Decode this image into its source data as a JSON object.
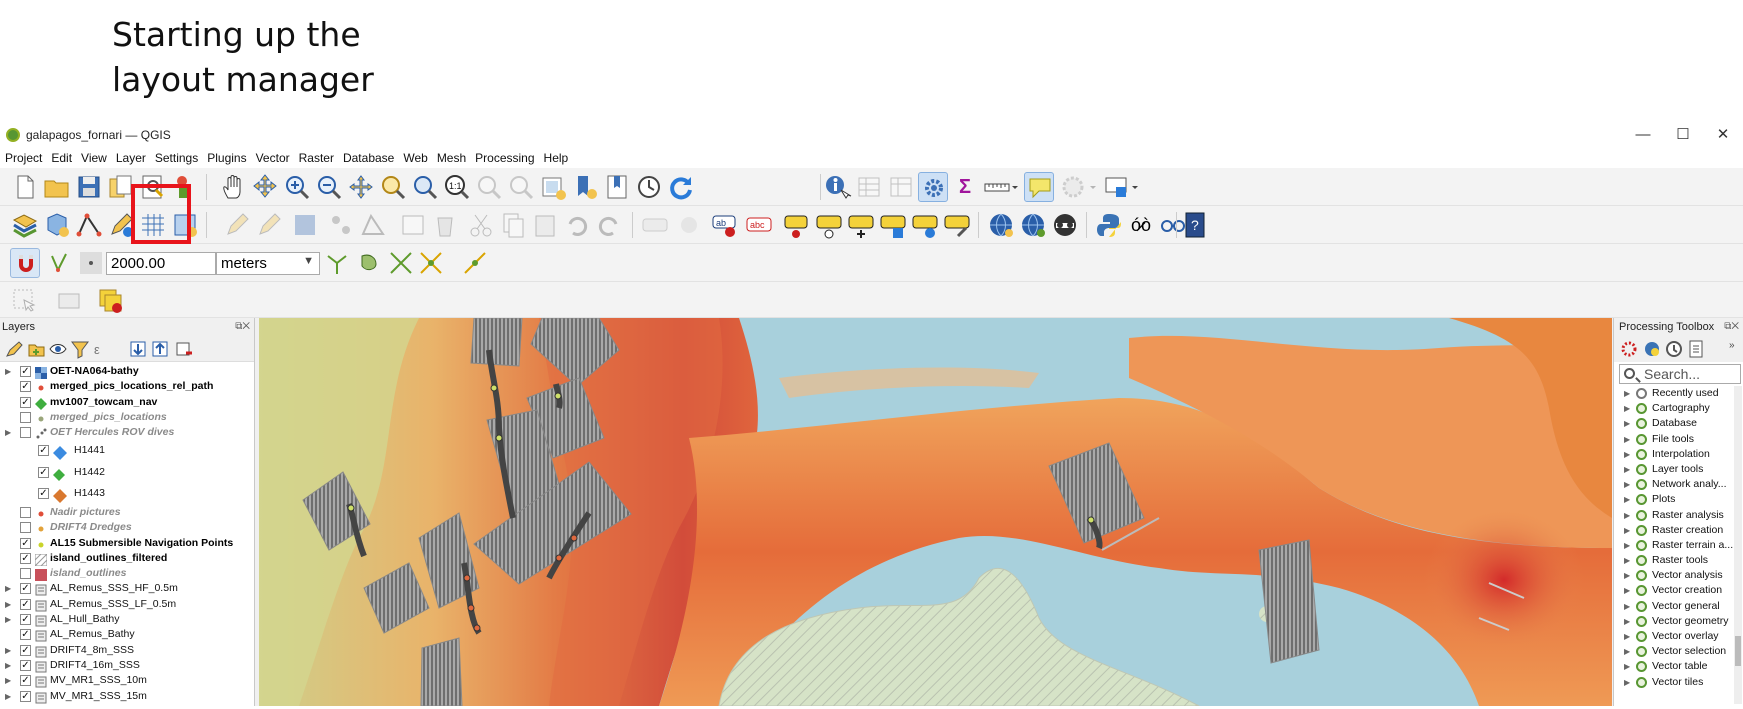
{
  "slide": {
    "title": "Starting up the\nlayout manager"
  },
  "window": {
    "title": "galapagos_fornari — QGIS",
    "minimize": "—",
    "maximize": "☐",
    "close": "✕"
  },
  "menu": [
    "Project",
    "Edit",
    "View",
    "Layer",
    "Settings",
    "Plugins",
    "Vector",
    "Raster",
    "Database",
    "Web",
    "Mesh",
    "Processing",
    "Help"
  ],
  "snapping": {
    "tolerance": "2000.00",
    "units": "meters"
  },
  "layers_panel": {
    "title": "Layers",
    "items": [
      {
        "name": "OET-NA064-bathy",
        "style": "bold",
        "checked": true,
        "expand": true,
        "symbol": "raster"
      },
      {
        "name": "merged_pics_locations_rel_path",
        "style": "bold",
        "checked": true,
        "expand": false,
        "symbol": "dot-red"
      },
      {
        "name": "mv1007_towcam_nav",
        "style": "bold",
        "checked": true,
        "expand": false,
        "symbol": "diamond-green"
      },
      {
        "name": "merged_pics_locations",
        "style": "grey",
        "checked": false,
        "expand": false,
        "symbol": "dot-grey"
      },
      {
        "name": "OET Hercules ROV dives",
        "style": "grey",
        "checked": false,
        "expand": true,
        "symbol": "dots"
      },
      {
        "name": "H1441",
        "style": "normal",
        "checked": true,
        "sub": true,
        "symbol": "diamond-blue"
      },
      {
        "name": "H1442",
        "style": "normal",
        "checked": true,
        "sub": true,
        "symbol": "diamond-green"
      },
      {
        "name": "H1443",
        "style": "normal",
        "checked": true,
        "sub": true,
        "symbol": "diamond-orange"
      },
      {
        "name": "Nadir pictures",
        "style": "grey",
        "checked": false,
        "symbol": "dot-red"
      },
      {
        "name": "DRIFT4 Dredges",
        "style": "grey",
        "checked": false,
        "symbol": "dot-orange"
      },
      {
        "name": "AL15 Submersible Navigation Points",
        "style": "bold",
        "checked": true,
        "symbol": "dot-yellow"
      },
      {
        "name": "island_outlines_filtered",
        "style": "bold",
        "checked": true,
        "symbol": "hatch"
      },
      {
        "name": "island_outlines",
        "style": "grey",
        "checked": false,
        "symbol": "fill-red"
      },
      {
        "name": "AL_Remus_SSS_HF_0.5m",
        "style": "normal",
        "checked": true,
        "expand": true,
        "symbol": "raster-grey"
      },
      {
        "name": "AL_Remus_SSS_LF_0.5m",
        "style": "normal",
        "checked": true,
        "expand": true,
        "symbol": "raster-grey"
      },
      {
        "name": "AL_Hull_Bathy",
        "style": "normal",
        "checked": true,
        "expand": true,
        "symbol": "raster-grey"
      },
      {
        "name": "AL_Remus_Bathy",
        "style": "normal",
        "checked": true,
        "expand": false,
        "symbol": "raster-grey"
      },
      {
        "name": "DRIFT4_8m_SSS",
        "style": "normal",
        "checked": true,
        "expand": true,
        "symbol": "raster-grey"
      },
      {
        "name": "DRIFT4_16m_SSS",
        "style": "normal",
        "checked": true,
        "expand": true,
        "symbol": "raster-grey"
      },
      {
        "name": "MV_MR1_SSS_10m",
        "style": "normal",
        "checked": true,
        "expand": true,
        "symbol": "raster-grey"
      },
      {
        "name": "MV_MR1_SSS_15m",
        "style": "normal",
        "checked": true,
        "expand": true,
        "symbol": "raster-grey"
      }
    ]
  },
  "processing_toolbox": {
    "title": "Processing Toolbox",
    "search_placeholder": "Search...",
    "items": [
      "Recently used",
      "Cartography",
      "Database",
      "File tools",
      "Interpolation",
      "Layer tools",
      "Network analy...",
      "Plots",
      "Raster analysis",
      "Raster creation",
      "Raster terrain a...",
      "Raster tools",
      "Vector analysis",
      "Vector creation",
      "Vector general",
      "Vector geometry",
      "Vector overlay",
      "Vector selection",
      "Vector table",
      "Vector tiles"
    ]
  },
  "colors": {
    "highlight": "#e8141b",
    "sea": "#a8d0dc",
    "land": "#c9dbb6",
    "qgis_green": "#589632"
  }
}
